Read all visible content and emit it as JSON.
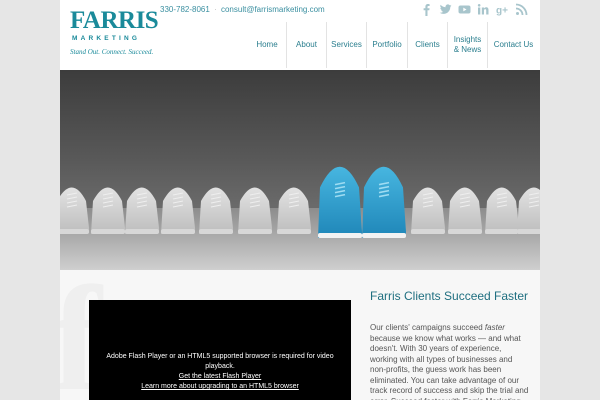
{
  "header": {
    "logo": {
      "word": "FARRIS",
      "sub": "MARKETING",
      "tagline": "Stand Out. Connect. Succeed."
    },
    "phone": "330-782-8061",
    "email": "consult@farrismarketing.com",
    "social": [
      "facebook-icon",
      "twitter-icon",
      "youtube-icon",
      "linkedin-icon",
      "googleplus-icon",
      "rss-icon"
    ],
    "nav": [
      {
        "label": "Home"
      },
      {
        "label": "About"
      },
      {
        "label": "Services"
      },
      {
        "label": "Portfolio"
      },
      {
        "label": "Clients"
      },
      {
        "label": "Insights\n& News"
      },
      {
        "label": "Contact Us"
      }
    ]
  },
  "hero": {
    "image": "row of white sneakers with one pair of blue sneakers"
  },
  "video": {
    "message": "Adobe Flash Player or an HTML5 supported browser is required for video playback.",
    "link1": "Get the latest Flash Player",
    "link2": "Learn more about upgrading to an HTML5 browser"
  },
  "side": {
    "title": "Farris Clients Succeed Faster",
    "text_before": "Our clients' campaigns succeed ",
    "text_em": "faster",
    "text_after": " because we know what works — and what doesn't. With 30 years of experience, working with all types of businesses and non-profits, the guess work has been eliminated. You can take advantage of our track record of success and skip the trial and error. Succeed faster with Farris Marketing."
  },
  "colors": {
    "accent": "#1a8a9a",
    "nav_text": "#2a7e8e",
    "blue_shoe": "#2aa0cf"
  }
}
